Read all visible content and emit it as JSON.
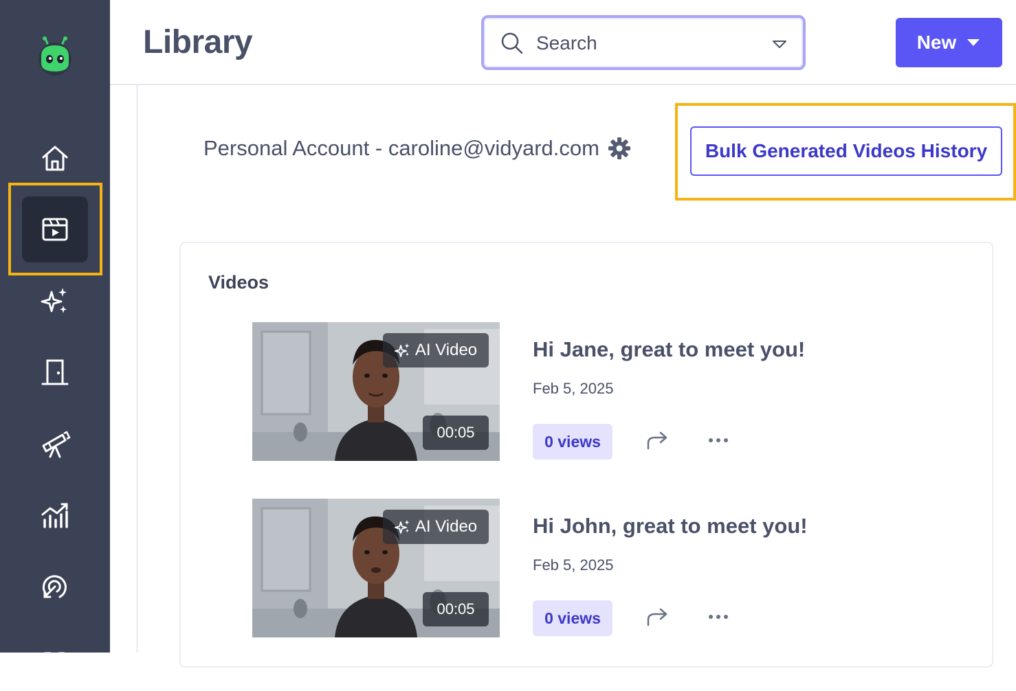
{
  "header": {
    "title": "Library",
    "search_placeholder": "Search",
    "new_label": "New"
  },
  "sidebar": {
    "items": [
      {
        "name": "home",
        "icon": "home-icon"
      },
      {
        "name": "library",
        "icon": "video-library-icon",
        "active": true
      },
      {
        "name": "ai",
        "icon": "sparkles-icon"
      },
      {
        "name": "rooms",
        "icon": "door-icon"
      },
      {
        "name": "prospecting",
        "icon": "telescope-icon"
      },
      {
        "name": "analytics",
        "icon": "analytics-chart-icon"
      },
      {
        "name": "engagement",
        "icon": "target-icon"
      },
      {
        "name": "apps",
        "icon": "apps-grid-icon"
      }
    ]
  },
  "content": {
    "account_label": "Personal Account - caroline@vidyard.com",
    "bulk_button_label": "Bulk Generated Videos History",
    "videos_heading": "Videos",
    "videos": [
      {
        "badge": "AI Video",
        "duration": "00:05",
        "title": "Hi Jane, great to meet you!",
        "date": "Feb 5, 2025",
        "views": "0 views"
      },
      {
        "badge": "AI Video",
        "duration": "00:05",
        "title": "Hi John, great to meet you!",
        "date": "Feb 5, 2025",
        "views": "0 views"
      }
    ]
  },
  "colors": {
    "sidebar_bg": "#3b4255",
    "accent": "#5a55f5",
    "highlight": "#f5b315",
    "logo_green": "#3fd36b"
  }
}
